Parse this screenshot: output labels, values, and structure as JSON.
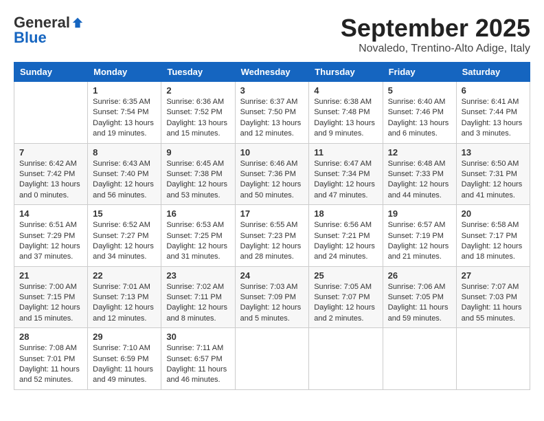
{
  "logo": {
    "general": "General",
    "blue": "Blue"
  },
  "header": {
    "month": "September 2025",
    "location": "Novaledo, Trentino-Alto Adige, Italy"
  },
  "weekdays": [
    "Sunday",
    "Monday",
    "Tuesday",
    "Wednesday",
    "Thursday",
    "Friday",
    "Saturday"
  ],
  "weeks": [
    [
      {
        "day": "",
        "info": ""
      },
      {
        "day": "1",
        "info": "Sunrise: 6:35 AM\nSunset: 7:54 PM\nDaylight: 13 hours\nand 19 minutes."
      },
      {
        "day": "2",
        "info": "Sunrise: 6:36 AM\nSunset: 7:52 PM\nDaylight: 13 hours\nand 15 minutes."
      },
      {
        "day": "3",
        "info": "Sunrise: 6:37 AM\nSunset: 7:50 PM\nDaylight: 13 hours\nand 12 minutes."
      },
      {
        "day": "4",
        "info": "Sunrise: 6:38 AM\nSunset: 7:48 PM\nDaylight: 13 hours\nand 9 minutes."
      },
      {
        "day": "5",
        "info": "Sunrise: 6:40 AM\nSunset: 7:46 PM\nDaylight: 13 hours\nand 6 minutes."
      },
      {
        "day": "6",
        "info": "Sunrise: 6:41 AM\nSunset: 7:44 PM\nDaylight: 13 hours\nand 3 minutes."
      }
    ],
    [
      {
        "day": "7",
        "info": "Sunrise: 6:42 AM\nSunset: 7:42 PM\nDaylight: 13 hours\nand 0 minutes."
      },
      {
        "day": "8",
        "info": "Sunrise: 6:43 AM\nSunset: 7:40 PM\nDaylight: 12 hours\nand 56 minutes."
      },
      {
        "day": "9",
        "info": "Sunrise: 6:45 AM\nSunset: 7:38 PM\nDaylight: 12 hours\nand 53 minutes."
      },
      {
        "day": "10",
        "info": "Sunrise: 6:46 AM\nSunset: 7:36 PM\nDaylight: 12 hours\nand 50 minutes."
      },
      {
        "day": "11",
        "info": "Sunrise: 6:47 AM\nSunset: 7:34 PM\nDaylight: 12 hours\nand 47 minutes."
      },
      {
        "day": "12",
        "info": "Sunrise: 6:48 AM\nSunset: 7:33 PM\nDaylight: 12 hours\nand 44 minutes."
      },
      {
        "day": "13",
        "info": "Sunrise: 6:50 AM\nSunset: 7:31 PM\nDaylight: 12 hours\nand 41 minutes."
      }
    ],
    [
      {
        "day": "14",
        "info": "Sunrise: 6:51 AM\nSunset: 7:29 PM\nDaylight: 12 hours\nand 37 minutes."
      },
      {
        "day": "15",
        "info": "Sunrise: 6:52 AM\nSunset: 7:27 PM\nDaylight: 12 hours\nand 34 minutes."
      },
      {
        "day": "16",
        "info": "Sunrise: 6:53 AM\nSunset: 7:25 PM\nDaylight: 12 hours\nand 31 minutes."
      },
      {
        "day": "17",
        "info": "Sunrise: 6:55 AM\nSunset: 7:23 PM\nDaylight: 12 hours\nand 28 minutes."
      },
      {
        "day": "18",
        "info": "Sunrise: 6:56 AM\nSunset: 7:21 PM\nDaylight: 12 hours\nand 24 minutes."
      },
      {
        "day": "19",
        "info": "Sunrise: 6:57 AM\nSunset: 7:19 PM\nDaylight: 12 hours\nand 21 minutes."
      },
      {
        "day": "20",
        "info": "Sunrise: 6:58 AM\nSunset: 7:17 PM\nDaylight: 12 hours\nand 18 minutes."
      }
    ],
    [
      {
        "day": "21",
        "info": "Sunrise: 7:00 AM\nSunset: 7:15 PM\nDaylight: 12 hours\nand 15 minutes."
      },
      {
        "day": "22",
        "info": "Sunrise: 7:01 AM\nSunset: 7:13 PM\nDaylight: 12 hours\nand 12 minutes."
      },
      {
        "day": "23",
        "info": "Sunrise: 7:02 AM\nSunset: 7:11 PM\nDaylight: 12 hours\nand 8 minutes."
      },
      {
        "day": "24",
        "info": "Sunrise: 7:03 AM\nSunset: 7:09 PM\nDaylight: 12 hours\nand 5 minutes."
      },
      {
        "day": "25",
        "info": "Sunrise: 7:05 AM\nSunset: 7:07 PM\nDaylight: 12 hours\nand 2 minutes."
      },
      {
        "day": "26",
        "info": "Sunrise: 7:06 AM\nSunset: 7:05 PM\nDaylight: 11 hours\nand 59 minutes."
      },
      {
        "day": "27",
        "info": "Sunrise: 7:07 AM\nSunset: 7:03 PM\nDaylight: 11 hours\nand 55 minutes."
      }
    ],
    [
      {
        "day": "28",
        "info": "Sunrise: 7:08 AM\nSunset: 7:01 PM\nDaylight: 11 hours\nand 52 minutes."
      },
      {
        "day": "29",
        "info": "Sunrise: 7:10 AM\nSunset: 6:59 PM\nDaylight: 11 hours\nand 49 minutes."
      },
      {
        "day": "30",
        "info": "Sunrise: 7:11 AM\nSunset: 6:57 PM\nDaylight: 11 hours\nand 46 minutes."
      },
      {
        "day": "",
        "info": ""
      },
      {
        "day": "",
        "info": ""
      },
      {
        "day": "",
        "info": ""
      },
      {
        "day": "",
        "info": ""
      }
    ]
  ]
}
